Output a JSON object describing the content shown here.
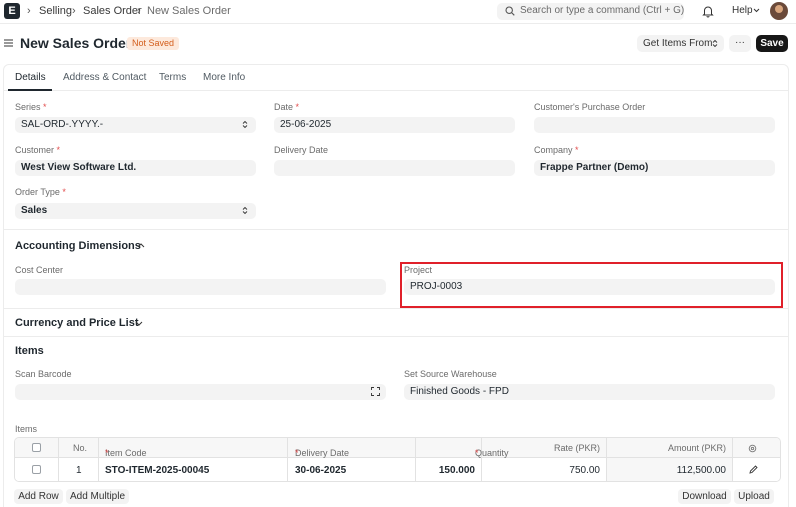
{
  "nav": {
    "logo": "E",
    "breadcrumbs": [
      "Selling",
      "Sales Order",
      "New Sales Order"
    ],
    "search_placeholder": "Search or type a command (Ctrl + G)",
    "help_label": "Help"
  },
  "header": {
    "title": "New Sales Order",
    "status_badge": "Not Saved",
    "get_items_label": "Get Items From",
    "more_label": "···",
    "save_label": "Save"
  },
  "tabs": [
    "Details",
    "Address & Contact",
    "Terms",
    "More Info"
  ],
  "fields": {
    "series": {
      "label": "Series",
      "value": "SAL-ORD-.YYYY.-"
    },
    "date": {
      "label": "Date",
      "value": "25-06-2025"
    },
    "customer_po": {
      "label": "Customer's Purchase Order",
      "value": ""
    },
    "customer": {
      "label": "Customer",
      "value": "West View Software Ltd."
    },
    "delivery_date": {
      "label": "Delivery Date",
      "value": ""
    },
    "company": {
      "label": "Company",
      "value": "Frappe Partner (Demo)"
    },
    "order_type": {
      "label": "Order Type",
      "value": "Sales"
    }
  },
  "accounting": {
    "title": "Accounting Dimensions",
    "cost_center": {
      "label": "Cost Center",
      "value": ""
    },
    "project": {
      "label": "Project",
      "value": "PROJ-0003"
    }
  },
  "currency_section": {
    "title": "Currency and Price List"
  },
  "items_section": {
    "title": "Items",
    "scan_barcode": {
      "label": "Scan Barcode",
      "value": ""
    },
    "source_warehouse": {
      "label": "Set Source Warehouse",
      "value": "Finished Goods - FPD"
    },
    "table_label": "Items",
    "columns": [
      "No.",
      "Item Code",
      "Delivery Date",
      "Quantity",
      "Rate (PKR)",
      "Amount (PKR)"
    ],
    "rows": [
      {
        "no": "1",
        "item_code": "STO-ITEM-2025-00045",
        "delivery_date": "30-06-2025",
        "quantity": "150.000",
        "rate": "750.00",
        "amount": "112,500.00"
      }
    ],
    "add_row_label": "Add Row",
    "add_multiple_label": "Add Multiple",
    "download_label": "Download",
    "upload_label": "Upload"
  }
}
